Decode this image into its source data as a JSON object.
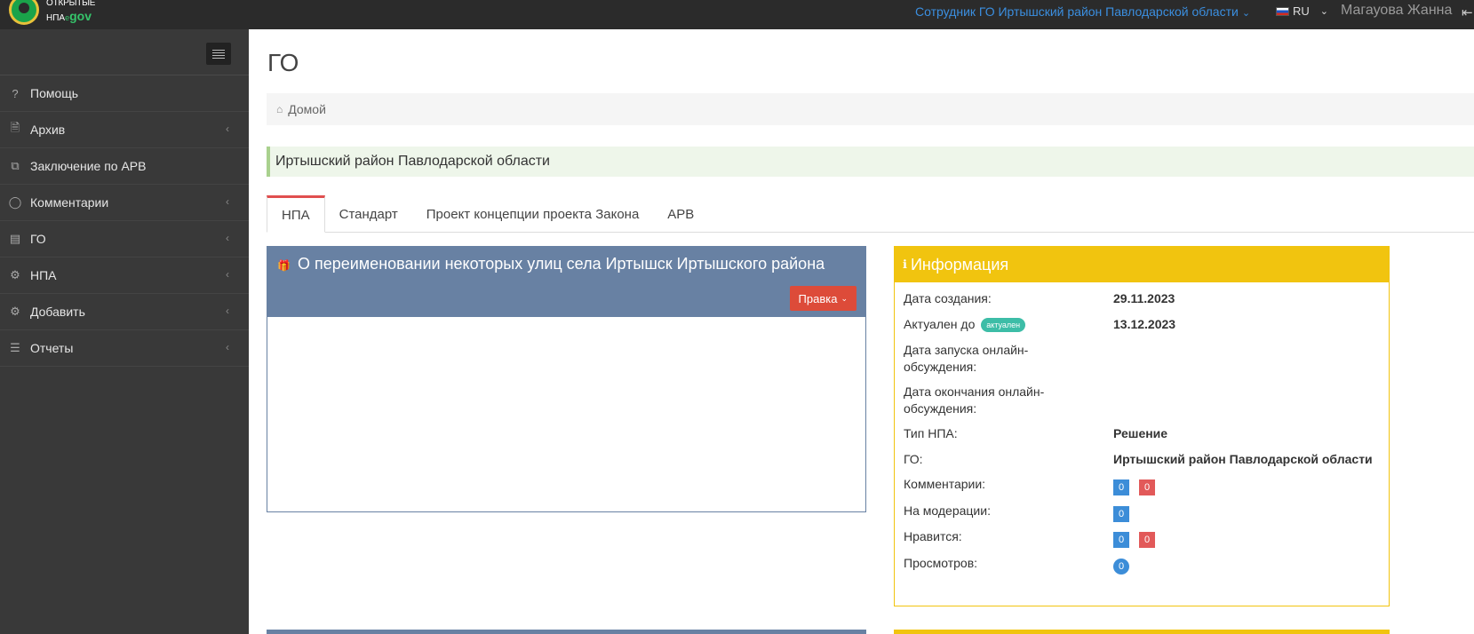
{
  "topbar": {
    "logo_line1": "ОТКРЫТЫЕ",
    "logo_line2_prefix": "НПА",
    "logo_line2_sub": "e",
    "logo_line2_gov": "gov",
    "role": "Сотрудник ГО Иртышский район Павлодарской области",
    "lang": "RU",
    "user": "Магауова Жанна"
  },
  "sidebar": {
    "items": [
      {
        "label": "Помощь",
        "icon": "question-icon"
      },
      {
        "label": "Архив",
        "icon": "archive-file-icon"
      },
      {
        "label": "Заключение по АРВ",
        "icon": "copy-icon"
      },
      {
        "label": "Комментарии",
        "icon": "comment-icon"
      },
      {
        "label": "ГО",
        "icon": "briefcase-icon"
      },
      {
        "label": "НПА",
        "icon": "gear-icon"
      },
      {
        "label": "Добавить",
        "icon": "gear-icon"
      },
      {
        "label": "Отчеты",
        "icon": "list-icon"
      }
    ]
  },
  "main": {
    "title": "ГО",
    "breadcrumb": "Домой",
    "region": "Иртышский район Павлодарской области",
    "tabs": [
      "НПА",
      "Стандарт",
      "Проект концепции проекта Закона",
      "АРВ"
    ],
    "document": {
      "title": "О переименовании некоторых улиц села Иртышск Иртышского района",
      "edit_label": "Правка"
    },
    "info": {
      "title": "Информация",
      "rows": {
        "created_label": "Дата создания:",
        "created_value": "29.11.2023",
        "actual_label": "Актуален до",
        "actual_badge": "актуален",
        "actual_value": "13.12.2023",
        "start_label": "Дата запуска онлайн-обсуждения:",
        "end_label": "Дата окончания онлайн-обсуждения:",
        "type_label": "Тип НПА:",
        "type_value": "Решение",
        "go_label": "ГО:",
        "go_value": "Иртышский район Павлодарской области",
        "comments_label": "Комментарии:",
        "comments_blue": "0",
        "comments_red": "0",
        "moderation_label": "На модерации:",
        "moderation_blue": "0",
        "likes_label": "Нравится:",
        "likes_blue": "0",
        "likes_red": "0",
        "views_label": "Просмотров:",
        "views_value": "0"
      }
    }
  },
  "colors": {
    "topbar": "#2b2b2b",
    "sidebar": "#393939",
    "doc_header": "#6881a3",
    "info_header": "#f1c40f",
    "edit_button": "#dd4b39",
    "role_link": "#3b8fe0"
  }
}
